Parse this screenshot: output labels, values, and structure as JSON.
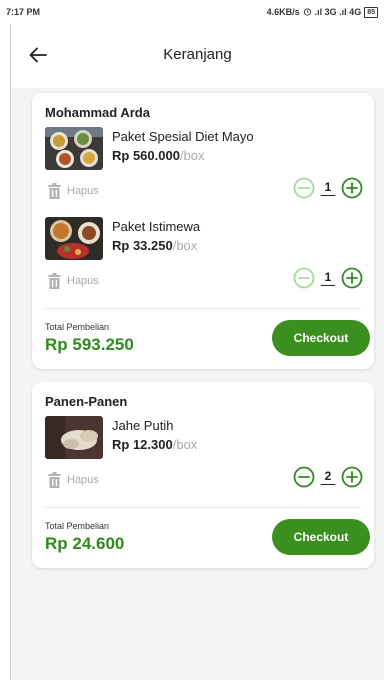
{
  "status_bar": {
    "time": "7:17 PM",
    "network": "4.6KB/s",
    "signal": ".ıl 3G .ıl 4G",
    "battery": "85"
  },
  "app_bar": {
    "back_icon": "arrow-left-icon",
    "title": "Keranjang"
  },
  "colors": {
    "accent": "#3a8f1f",
    "price_green": "#2e8b1e",
    "muted": "#aaaaaa",
    "background": "#f4f4f4"
  },
  "carts": [
    {
      "seller": "Mohammad Arda",
      "items": [
        {
          "name": "Paket Spesial Diet Mayo",
          "price": "Rp 560.000",
          "unit": "/box",
          "quantity": "1",
          "delete_label": "Hapus"
        },
        {
          "name": "Paket Istimewa",
          "price": "Rp 33.250",
          "unit": "/box",
          "quantity": "1",
          "delete_label": "Hapus"
        }
      ],
      "total_label": "Total Pembelian",
      "total_value": "Rp 593.250",
      "checkout_label": "Checkout"
    },
    {
      "seller": "Panen-Panen",
      "items": [
        {
          "name": "Jahe Putih",
          "price": "Rp 12.300",
          "unit": "/box",
          "quantity": "2",
          "delete_label": "Hapus"
        }
      ],
      "total_label": "Total Pembelian",
      "total_value": "Rp 24.600",
      "checkout_label": "Checkout"
    }
  ]
}
